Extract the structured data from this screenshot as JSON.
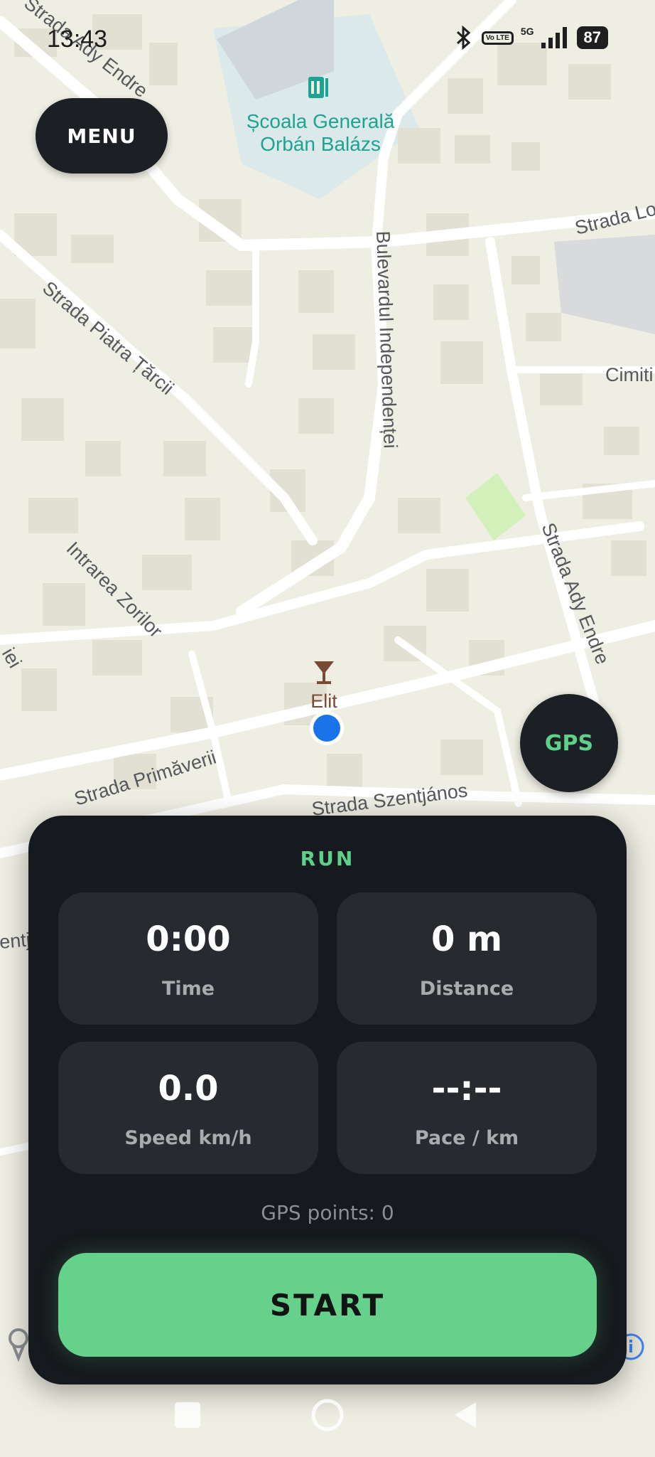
{
  "status_bar": {
    "time": "13:43",
    "network": "5G",
    "volte": "Vo LTE",
    "battery": "87"
  },
  "map": {
    "school_name_line1": "Școala Generală",
    "school_name_line2": "Orbán Balázs",
    "poi_name": "Elit",
    "streets": {
      "ady_endre_top": "Strada Ady Endre",
      "ady_endre_right": "Strada Ady Endre",
      "lorant": "Strada Lorán",
      "bulevardul": "Bulevardul Independenței",
      "piatra_tarcii": "Strada Piatra Țărcii",
      "zorilor": "Intrarea Zorilor",
      "primaverii": "Strada Primăverii",
      "szentjanos": "Strada Szentjános",
      "cimitir": "Cimiti",
      "left_fragment": "iei",
      "left_fragment2": "entj"
    }
  },
  "menu_button": {
    "label": "MENU"
  },
  "gps_button": {
    "label": "GPS"
  },
  "panel": {
    "title": "RUN",
    "stats": [
      {
        "value": "0:00",
        "label": "Time"
      },
      {
        "value": "0 m",
        "label": "Distance"
      },
      {
        "value": "0.0",
        "label": "Speed km/h"
      },
      {
        "value": "--:--",
        "label": "Pace / km"
      }
    ],
    "gps_points": "GPS points: 0",
    "start_label": "START"
  },
  "colors": {
    "accent": "#65d18a",
    "panel": "#16191d",
    "card": "#272a2e",
    "map_bg": "#efeee3",
    "location_dot": "#1a73e8"
  },
  "icons": [
    "bluetooth-icon",
    "signal-icon",
    "cocktail-icon",
    "school-icon",
    "home-icon",
    "back-icon",
    "recents-icon",
    "info-icon",
    "map-pin-icon"
  ]
}
